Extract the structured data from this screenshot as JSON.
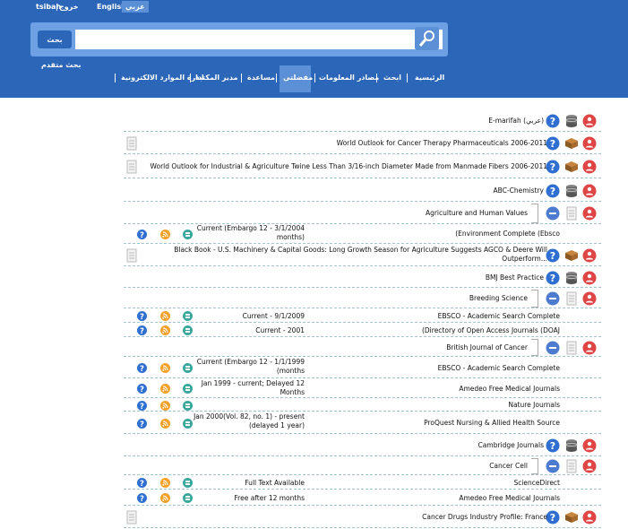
{
  "header": {
    "login": "tsibah",
    "register": "ﺧﺮﻭﺝ",
    "lang_en": "English",
    "lang_ar": "ﻋﺮﺑﻲ",
    "search_button": "ﺑﺤﺚ",
    "search_value": "",
    "advanced_search": "ﺑﺤﺚ ﻣﺘﻘﺪﻡ"
  },
  "nav": [
    "ﺍﻟﺮﺋﻴﺴﻴﺔ",
    "ﺍﺑﺤﺚ",
    "ﻣﺼﺎﺩﺭ ﺍﻟﻤﻌﻠﻮﻣﺎﺕ",
    "ﻣﻔﻀﻠﺘﻲ",
    "ﻣﺴﺎﻋﺪﺓ",
    "ﻣﺪﻳﺮ ﺍﻟﻤﻜﺘﺒﺔ",
    "ﺍﺩﺍﺭﺓ ﺍﻟﻤﻮﺍﺭﺩ ﺍﻻﻟﻜﺘﺮﻭﻧﻴﺔ"
  ],
  "rows": [
    {
      "title": "E-marifah (ﻋﺮﺑﻲ)",
      "kind": "database"
    },
    {
      "title": "World Outlook for Cancer Therapy Pharmaceuticals 2006-2011",
      "kind": "book"
    },
    {
      "title": "World Outlook for Industrial & Agriculture Twine Less Than 3/16-inch Diameter Made from Manmade Fibers 2006-2011",
      "kind": "book"
    },
    {
      "title": "ABC-Chemistry",
      "kind": "database"
    },
    {
      "title": "Agriculture and Human Values",
      "kind": "journal"
    },
    {
      "title": "(Environment Complete (Ebsco",
      "kind": "link",
      "coverage": [
        "Current (Embargo 12 - 3/1/2004",
        "months)"
      ]
    },
    {
      "title": "Black Book - U.S. Machinery & Capital Goods: Long Growth Season for Agriculture Suggests AGCO & Deere Will",
      "title2": "Outperform...",
      "kind": "book"
    },
    {
      "title": "BMJ Best Practice",
      "kind": "database"
    },
    {
      "title": "Breeding Science",
      "kind": "journal"
    },
    {
      "title": "EBSCO - Academic Search Complete",
      "kind": "link",
      "coverage": [
        "Current - 9/1/2009"
      ]
    },
    {
      "title": "(Directory of Open Access Journals (DOAJ",
      "kind": "link",
      "coverage": [
        "Current - 2001"
      ]
    },
    {
      "title": "British Journal of Cancer",
      "kind": "journal"
    },
    {
      "title": "EBSCO - Academic Search Complete",
      "kind": "link",
      "coverage": [
        "Current (Embargo 12 - 1/1/1999",
        "(months"
      ]
    },
    {
      "title": "Amedeo Free Medical Journals",
      "kind": "link",
      "coverage": [
        "Jan 1999 - current; Delayed 12",
        "Months"
      ]
    },
    {
      "title": "Nature Journals",
      "kind": "link",
      "coverage": []
    },
    {
      "title": "ProQuest Nursing & Allied Health Source",
      "kind": "link",
      "coverage": [
        "Jan 2000(Vol. 82, no. 1) - present",
        "(delayed 1 year)"
      ]
    },
    {
      "title": "Cambridge Journals",
      "kind": "database"
    },
    {
      "title": "Cancer Cell",
      "kind": "journal"
    },
    {
      "title": "ScienceDirect",
      "kind": "link",
      "coverage": [
        "Full Text Available"
      ]
    },
    {
      "title": "Amedeo Free Medical Journals",
      "kind": "link",
      "coverage": [
        "Free after 12 months"
      ]
    },
    {
      "title": "Cancer Drugs Industry Profile: France",
      "kind": "book"
    }
  ],
  "colors": {
    "header": "#2b66b8",
    "accent": "#5b8fd6",
    "row_border": "#9ec6cc",
    "help": "#2f6fd1",
    "rss": "#f3a12b",
    "table": "#3aa79c",
    "remove": "#e04545"
  }
}
